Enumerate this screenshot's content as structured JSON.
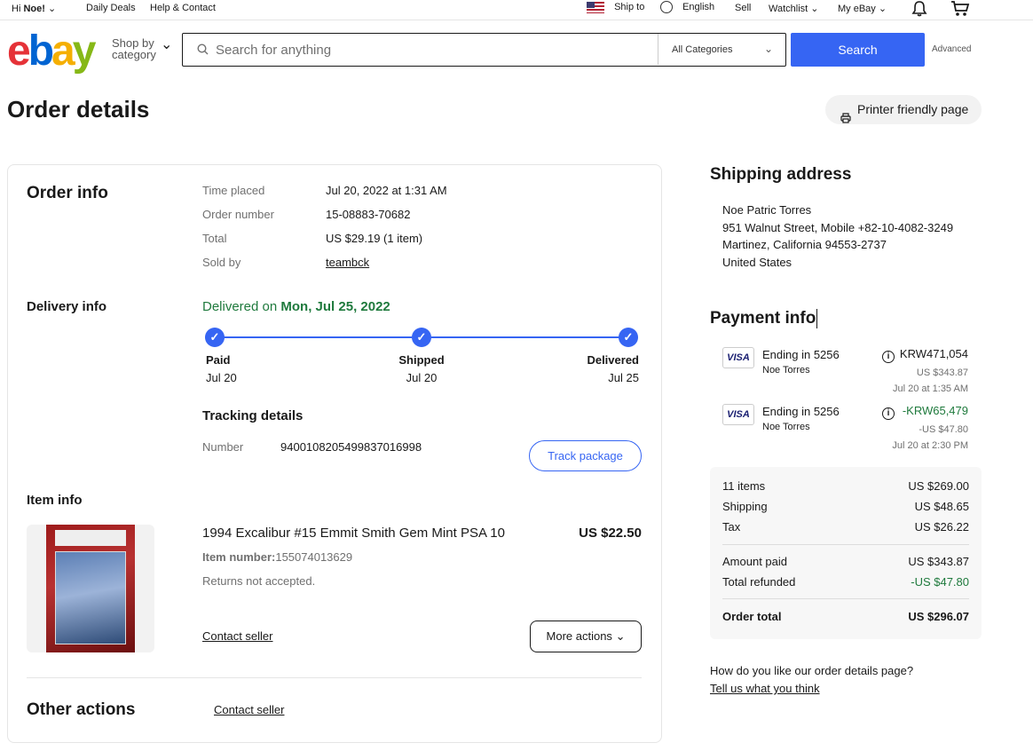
{
  "topnav": {
    "greeting_prefix": "Hi ",
    "user": "Noe!",
    "daily_deals": "Daily Deals",
    "help": "Help & Contact",
    "ship_to": "Ship to",
    "language": "English",
    "sell": "Sell",
    "watchlist": "Watchlist",
    "my_ebay": "My eBay"
  },
  "header": {
    "logo": [
      "e",
      "b",
      "a",
      "y"
    ],
    "shop_by": "Shop by",
    "category": "category",
    "search_placeholder": "Search for anything",
    "category_select": "All Categories",
    "search_button": "Search",
    "advanced": "Advanced"
  },
  "page": {
    "title": "Order details",
    "print_button": "Printer friendly page"
  },
  "order_info": {
    "heading": "Order info",
    "rows": [
      {
        "label": "Time placed",
        "value": "Jul 20, 2022 at 1:31 AM"
      },
      {
        "label": "Order number",
        "value": "15-08883-70682"
      },
      {
        "label": "Total",
        "value": "US $29.19 (1 item)"
      },
      {
        "label": "Sold by",
        "value": "teambck"
      }
    ]
  },
  "delivery": {
    "heading": "Delivery info",
    "status_prefix": "Delivered on ",
    "status_date": "Mon, Jul 25, 2022",
    "steps": [
      {
        "label": "Paid",
        "date": "Jul 20"
      },
      {
        "label": "Shipped",
        "date": "Jul 20"
      },
      {
        "label": "Delivered",
        "date": "Jul 25"
      }
    ],
    "tracking_heading": "Tracking details",
    "number_label": "Number",
    "tracking_number": "9400108205499837016998",
    "track_button": "Track package"
  },
  "item": {
    "heading": "Item info",
    "title": "1994 Excalibur #15 Emmit Smith Gem Mint PSA 10",
    "price": "US $22.50",
    "item_number_label": "Item number:",
    "item_number": "155074013629",
    "returns": "Returns not accepted.",
    "contact_seller": "Contact seller",
    "more_actions": "More actions"
  },
  "other_actions": {
    "heading": "Other actions",
    "contact_seller": "Contact seller"
  },
  "shipping": {
    "heading": "Shipping address",
    "lines": [
      "Noe Patric Torres",
      "951 Walnut Street, Mobile +82-10-4082-3249",
      "Martinez, California 94553-2737",
      "United States"
    ]
  },
  "payment": {
    "heading": "Payment info",
    "entries": [
      {
        "card": "VISA",
        "ending": "Ending in 5256",
        "name": "Noe Torres",
        "amount": "KRW471,054",
        "usd": "US $343.87",
        "date": "Jul 20 at 1:35 AM"
      },
      {
        "card": "VISA",
        "ending": "Ending in 5256",
        "name": "Noe Torres",
        "amount": "-KRW65,479",
        "usd": "-US $47.80",
        "date": "Jul 20 at 2:30 PM"
      }
    ]
  },
  "summary": {
    "rows": [
      {
        "label": "11 items",
        "value": "US $269.00"
      },
      {
        "label": "Shipping",
        "value": "US $48.65"
      },
      {
        "label": "Tax",
        "value": "US $26.22"
      },
      {
        "label": "Amount paid",
        "value": "US $343.87"
      },
      {
        "label": "Total refunded",
        "value": "-US $47.80"
      }
    ],
    "total_label": "Order total",
    "total_value": "US $296.07"
  },
  "feedback": {
    "question": "How do you like our order details page?",
    "link": "Tell us what you think"
  },
  "colors": {
    "accent": "#3665f3",
    "success": "#1f7a3d"
  }
}
